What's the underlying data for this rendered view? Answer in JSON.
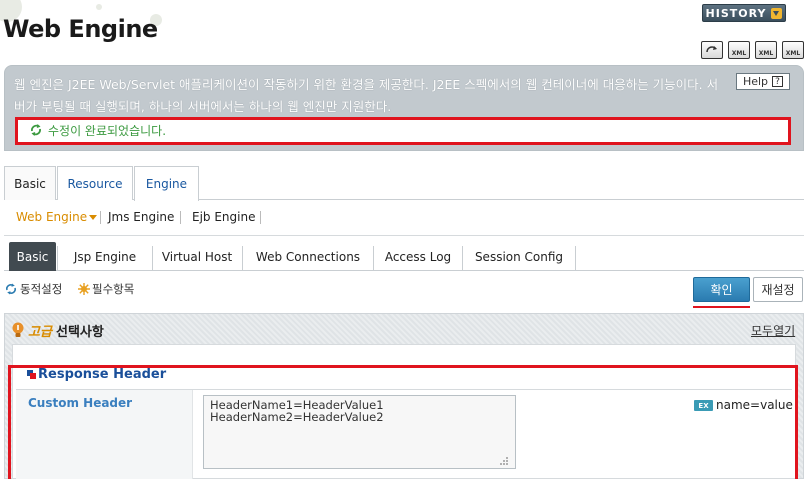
{
  "header": {
    "title": "Web Engine",
    "history_label": "HISTORY",
    "toolbar_icons": [
      {
        "name": "refresh-icon",
        "text": ""
      },
      {
        "name": "xml-icon",
        "text": "XML"
      },
      {
        "name": "xml-export-icon",
        "text": "XML"
      },
      {
        "name": "xml-import-icon",
        "text": "XML"
      }
    ]
  },
  "info": {
    "description": "웹 엔진은 J2EE Web/Servlet 애플리케이션이 작동하기 위한 환경을 제공한다. J2EE 스펙에서의 웹 컨테이너에 대응하는 기능이다. 서버가 부팅될 때 실행되며, 하나의 서버에서는 하나의 웹 엔진만 지원한다.",
    "help_label": "Help",
    "help_icon_text": "?",
    "message": "수정이 완료되었습니다."
  },
  "main_tabs": [
    {
      "label": "Basic"
    },
    {
      "label": "Resource"
    },
    {
      "label": "Engine"
    }
  ],
  "subnav": [
    {
      "label": "Web Engine"
    },
    {
      "label": "Jms Engine"
    },
    {
      "label": "Ejb Engine"
    }
  ],
  "engine_tabs": [
    {
      "label": "Basic"
    },
    {
      "label": "Jsp Engine"
    },
    {
      "label": "Virtual Host"
    },
    {
      "label": "Web Connections"
    },
    {
      "label": "Access Log"
    },
    {
      "label": "Session Config"
    }
  ],
  "legend": {
    "dynamic": "동적설정",
    "required": "필수항목"
  },
  "actions": {
    "ok": "확인",
    "reset": "재설정"
  },
  "advanced": {
    "title_prefix": "고급",
    "title": "선택사항",
    "expand_all": "모두열기"
  },
  "response_header": {
    "title": "Response Header",
    "field_label": "Custom Header",
    "value": "HeaderName1=HeaderValue1\nHeaderName2=HeaderValue2",
    "example_badge": "EX",
    "example_text": "name=value"
  },
  "colors": {
    "highlight_red": "#e0141e",
    "accent_blue": "#1a58a0",
    "accent_orange": "#d98c00",
    "success_green": "#3c9a40"
  }
}
